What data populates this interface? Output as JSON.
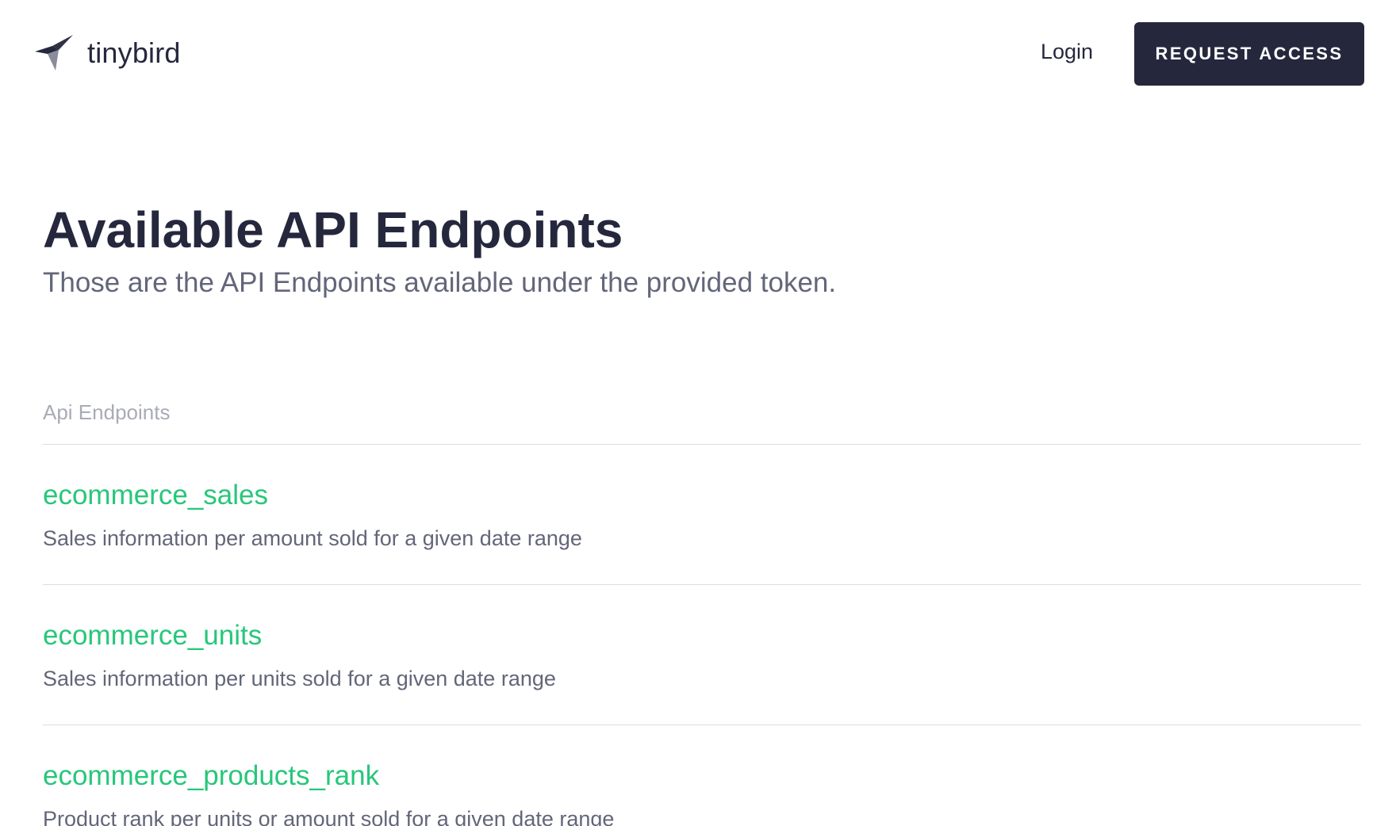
{
  "header": {
    "brand_name": "tinybird",
    "brand_icon": "tinybird-logo-icon",
    "login_label": "Login",
    "request_access_label": "REQUEST ACCESS"
  },
  "hero": {
    "title": "Available API Endpoints",
    "subtitle": "Those are the API Endpoints available under the provided token."
  },
  "list": {
    "header": "Api Endpoints",
    "endpoints": [
      {
        "name": "ecommerce_sales",
        "description": "Sales information per amount sold for a given date range"
      },
      {
        "name": "ecommerce_units",
        "description": "Sales information per units sold for a given date range"
      },
      {
        "name": "ecommerce_products_rank",
        "description": "Product rank per units or amount sold for a given date range"
      }
    ]
  },
  "colors": {
    "primary_dark": "#25283d",
    "accent_green": "#27c77a",
    "muted_text": "#636679",
    "light_text": "#a9abb6",
    "divider": "#dcdde2"
  }
}
